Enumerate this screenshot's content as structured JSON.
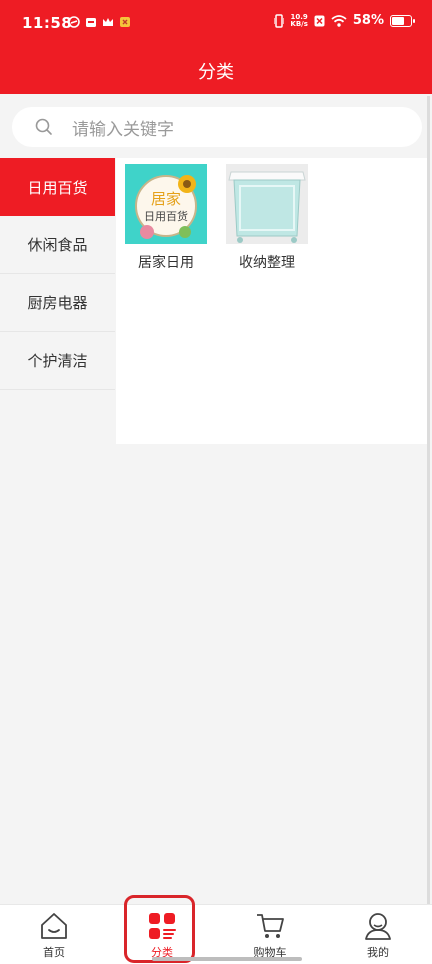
{
  "status": {
    "time": "11:58",
    "speed_top": "10.9",
    "speed_bottom": "KB/s",
    "battery": "58%",
    "battery_level": 0.58
  },
  "header": {
    "title": "分类"
  },
  "search": {
    "placeholder": "请输入关键字"
  },
  "sidebar": {
    "items": [
      {
        "label": "日用百货"
      },
      {
        "label": "休闲食品"
      },
      {
        "label": "厨房电器"
      },
      {
        "label": "个护清洁"
      }
    ]
  },
  "products": [
    {
      "name": "居家日用",
      "thumb_text_top": "居家",
      "thumb_text_bottom": "日用百货"
    },
    {
      "name": "收纳整理"
    }
  ],
  "tabbar": {
    "items": [
      {
        "label": "首页"
      },
      {
        "label": "分类"
      },
      {
        "label": "购物车"
      },
      {
        "label": "我的"
      }
    ]
  },
  "colors": {
    "accent": "#ee1c24"
  }
}
